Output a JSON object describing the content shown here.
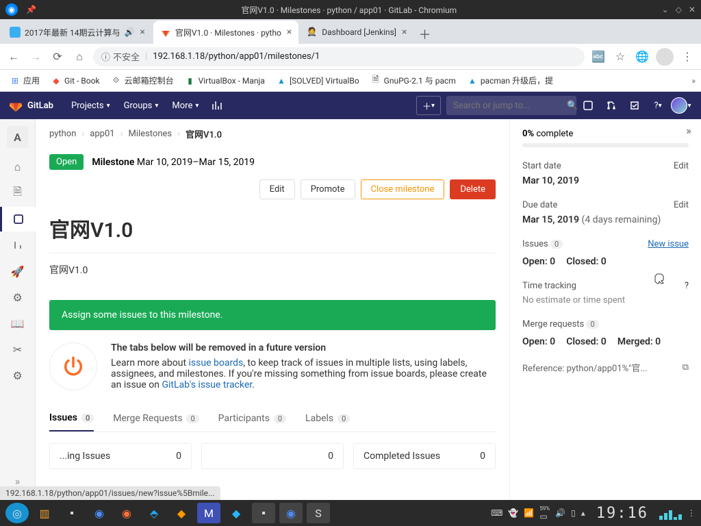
{
  "window": {
    "title": "官网V1.0 · Milestones · python / app01 · GitLab - Chromium"
  },
  "browser": {
    "tabs": [
      {
        "label": "2017年最新 14期云计算与",
        "active": false,
        "audio": true
      },
      {
        "label": "官网V1.0 · Milestones · pytho",
        "active": true
      },
      {
        "label": "Dashboard [Jenkins]",
        "active": false
      }
    ],
    "url_security": "不安全",
    "url": "192.168.1.18/python/app01/milestones/1",
    "status_url": "192.168.1.18/python/app01/issues/new?issue%5Bmile..."
  },
  "bookmarks": [
    {
      "label": "应用"
    },
    {
      "label": "Git - Book"
    },
    {
      "label": "云邮箱控制台"
    },
    {
      "label": "VirtualBox - Manja"
    },
    {
      "label": "[SOLVED] VirtualBo"
    },
    {
      "label": "GnuPG-2.1 与 pacm"
    },
    {
      "label": "pacman 升级后，提"
    }
  ],
  "gitlab": {
    "brand": "GitLab",
    "nav": {
      "projects": "Projects",
      "groups": "Groups",
      "more": "More"
    },
    "search_placeholder": "Search or jump to...",
    "project_initial": "A"
  },
  "breadcrumb": {
    "p1": "python",
    "p2": "app01",
    "p3": "Milestones",
    "p4": "官网V1.0"
  },
  "milestone": {
    "status": "Open",
    "label": "Milestone",
    "daterange": "Mar 10, 2019–Mar 15, 2019",
    "title": "官网V1.0",
    "description": "官网V1.0",
    "actions": {
      "edit": "Edit",
      "promote": "Promote",
      "close": "Close milestone",
      "delete": "Delete"
    },
    "assign_alert": "Assign some issues to this milestone.",
    "deprecation": {
      "heading": "The tabs below will be removed in a future version",
      "body1": "Learn more about ",
      "link1": "issue boards",
      "body2": ", to keep track of issues in multiple lists, using labels, assignees, and milestones. If you're missing something from issue boards, please create an issue on ",
      "link2": "GitLab's issue tracker",
      "body3": "."
    }
  },
  "tabs": {
    "issues": "Issues",
    "issues_n": "0",
    "mr": "Merge Requests",
    "mr_n": "0",
    "participants": "Participants",
    "participants_n": "0",
    "labels": "Labels",
    "labels_n": "0"
  },
  "issue_columns": {
    "col1_label": "...ing Issues",
    "col1_n": "0",
    "col2_label": "",
    "col2_n": "0",
    "col3_label": "Completed Issues",
    "col3_n": "0"
  },
  "sidebar": {
    "complete_pct": "0%",
    "complete_label": "complete",
    "start_label": "Start date",
    "start_edit": "Edit",
    "start_val": "Mar 10, 2019",
    "due_label": "Due date",
    "due_edit": "Edit",
    "due_val": "Mar 15, 2019",
    "due_remaining": "(4 days remaining)",
    "issues_label": "Issues",
    "issues_n": "0",
    "new_issue": "New issue",
    "open_label": "Open: 0",
    "closed_label": "Closed: 0",
    "tt_label": "Time tracking",
    "tt_val": "No estimate or time spent",
    "mr_label": "Merge requests",
    "mr_n": "0",
    "mr_open": "Open: 0",
    "mr_closed": "Closed: 0",
    "mr_merged": "Merged: 0",
    "reference": "Reference: python/app01%\"官..."
  },
  "clock": "19:16"
}
